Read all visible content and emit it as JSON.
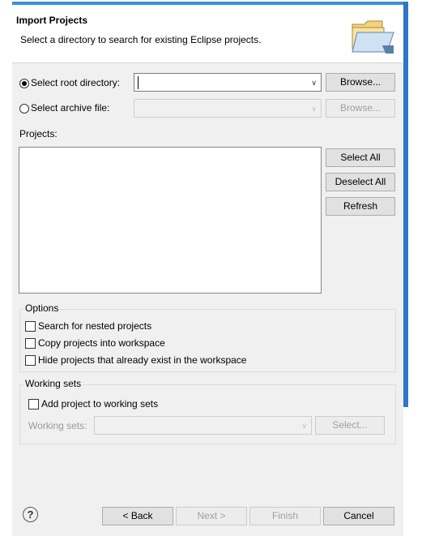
{
  "header": {
    "title": "Import Projects",
    "subtitle": "Select a directory to search for existing Eclipse projects."
  },
  "source": {
    "root_label": "Select root directory:",
    "root_value": "",
    "archive_label": "Select archive file:",
    "archive_value": "",
    "browse_label": "Browse..."
  },
  "projects": {
    "label": "Projects:",
    "select_all": "Select All",
    "deselect_all": "Deselect All",
    "refresh": "Refresh",
    "items": []
  },
  "options": {
    "title": "Options",
    "nested": "Search for nested projects",
    "copy": "Copy projects into workspace",
    "hide": "Hide projects that already exist in the workspace"
  },
  "working_sets": {
    "title": "Working sets",
    "add": "Add project to working sets",
    "label": "Working sets:",
    "value": "",
    "select": "Select..."
  },
  "footer": {
    "help": "?",
    "back": "< Back",
    "next": "Next >",
    "finish": "Finish",
    "cancel": "Cancel"
  },
  "colors": {
    "accent": "#3c8fd6",
    "dialog_bg": "#f0f0f0",
    "disabled_text": "#a0a0a0"
  },
  "icons": {
    "header": "folder-open-icon",
    "dropdown": "chevron-down-icon",
    "help": "help-icon"
  }
}
